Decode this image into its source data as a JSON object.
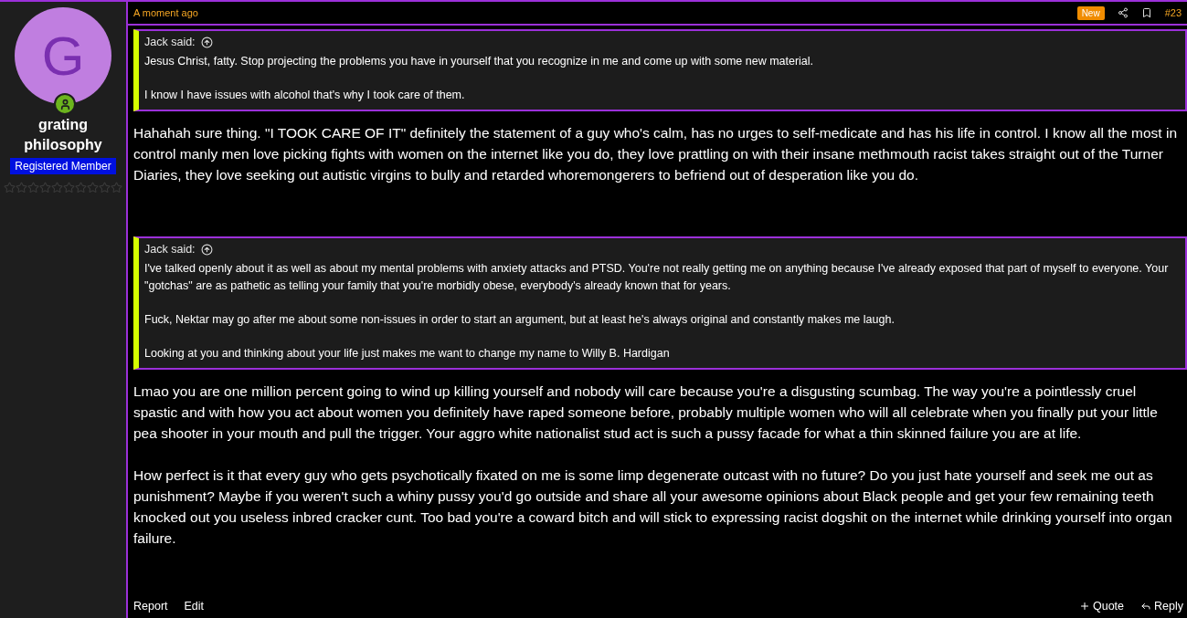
{
  "author": {
    "avatar_letter": "G",
    "name": "grating philosophy",
    "role": "Registered Member",
    "stars": 0,
    "online": true
  },
  "post": {
    "time": "A moment ago",
    "badge": "New",
    "number": "#23",
    "blocks": [
      {
        "kind": "quote",
        "author": "Jack said:",
        "paragraphs": [
          "Jesus Christ, fatty. Stop projecting the problems you have in yourself that you recognize in me and come up with some new material.",
          "I know I have issues with alcohol that's why I took care of them."
        ]
      },
      {
        "kind": "text",
        "text": "Hahahah sure thing. \"I TOOK CARE OF IT\" definitely the statement of a guy who's calm, has no urges to self-medicate and has his life in control. I know all the most in control manly men love picking fights with women on the internet like you do, they love prattling on with their insane methmouth racist takes straight out of the Turner Diaries, they love seeking out autistic virgins to bully and retarded whoremongerers to befriend out of desperation like you do."
      },
      {
        "kind": "quote",
        "author": "Jack said:",
        "paragraphs": [
          "I've talked openly about it as well as about my mental problems with anxiety attacks and PTSD. You're not really getting me on anything because I've already exposed that part of myself to everyone. Your \"gotchas\" are as pathetic as telling your family that you're morbidly obese, everybody's already known that for years.",
          "Fuck, Nektar may go after me about some non-issues in order to start an argument, but at least he's always original and constantly makes me laugh.",
          "Looking at you and thinking about your life just makes me want to change my name to Willy B. Hardigan"
        ]
      },
      {
        "kind": "text",
        "text": "Lmao you are one million percent going to wind up killing yourself and nobody will care because you're a disgusting scumbag. The way you're a pointlessly cruel spastic and with how you act about women you definitely have raped someone before, probably multiple women who will all celebrate when you finally put your little pea shooter in your mouth and pull the trigger. Your aggro white nationalist stud act is such a pussy facade for what a thin skinned failure you are at life."
      },
      {
        "kind": "text",
        "text": "How perfect is it that every guy who gets psychotically fixated on me is some limp degenerate outcast with no future? Do you just hate yourself and seek me out as punishment? Maybe if you weren't such a whiny pussy you'd go outside and share all your awesome opinions about Black people and get your few remaining teeth knocked out you useless inbred cracker cunt. Too bad you're a coward bitch and will stick to expressing racist dogshit on the internet while drinking yourself into organ failure."
      }
    ],
    "actions_left": [
      "Report",
      "Edit"
    ],
    "actions_right": [
      {
        "kind": "quote",
        "label": "Quote"
      },
      {
        "kind": "reply",
        "label": "Reply"
      }
    ]
  }
}
